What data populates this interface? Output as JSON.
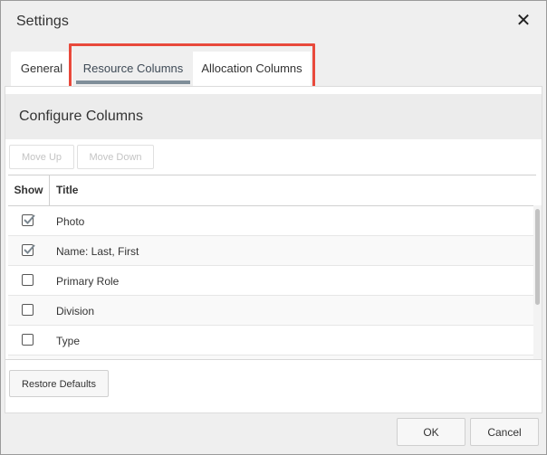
{
  "dialog": {
    "title": "Settings",
    "close_icon": "close-icon"
  },
  "tabs": [
    {
      "label": "General",
      "selected": false
    },
    {
      "label": "Resource Columns",
      "selected": true
    },
    {
      "label": "Allocation Columns",
      "selected": false
    }
  ],
  "highlight_color": "#e8493b",
  "section": {
    "title": "Configure Columns",
    "move_up": "Move Up",
    "move_down": "Move Down"
  },
  "grid": {
    "headers": {
      "show": "Show",
      "title": "Title"
    },
    "rows": [
      {
        "title": "Photo",
        "show": true
      },
      {
        "title": "Name: Last, First",
        "show": true
      },
      {
        "title": "Primary Role",
        "show": false
      },
      {
        "title": "Division",
        "show": false
      },
      {
        "title": "Type",
        "show": false
      }
    ]
  },
  "buttons": {
    "restore_defaults": "Restore Defaults",
    "ok": "OK",
    "cancel": "Cancel"
  }
}
